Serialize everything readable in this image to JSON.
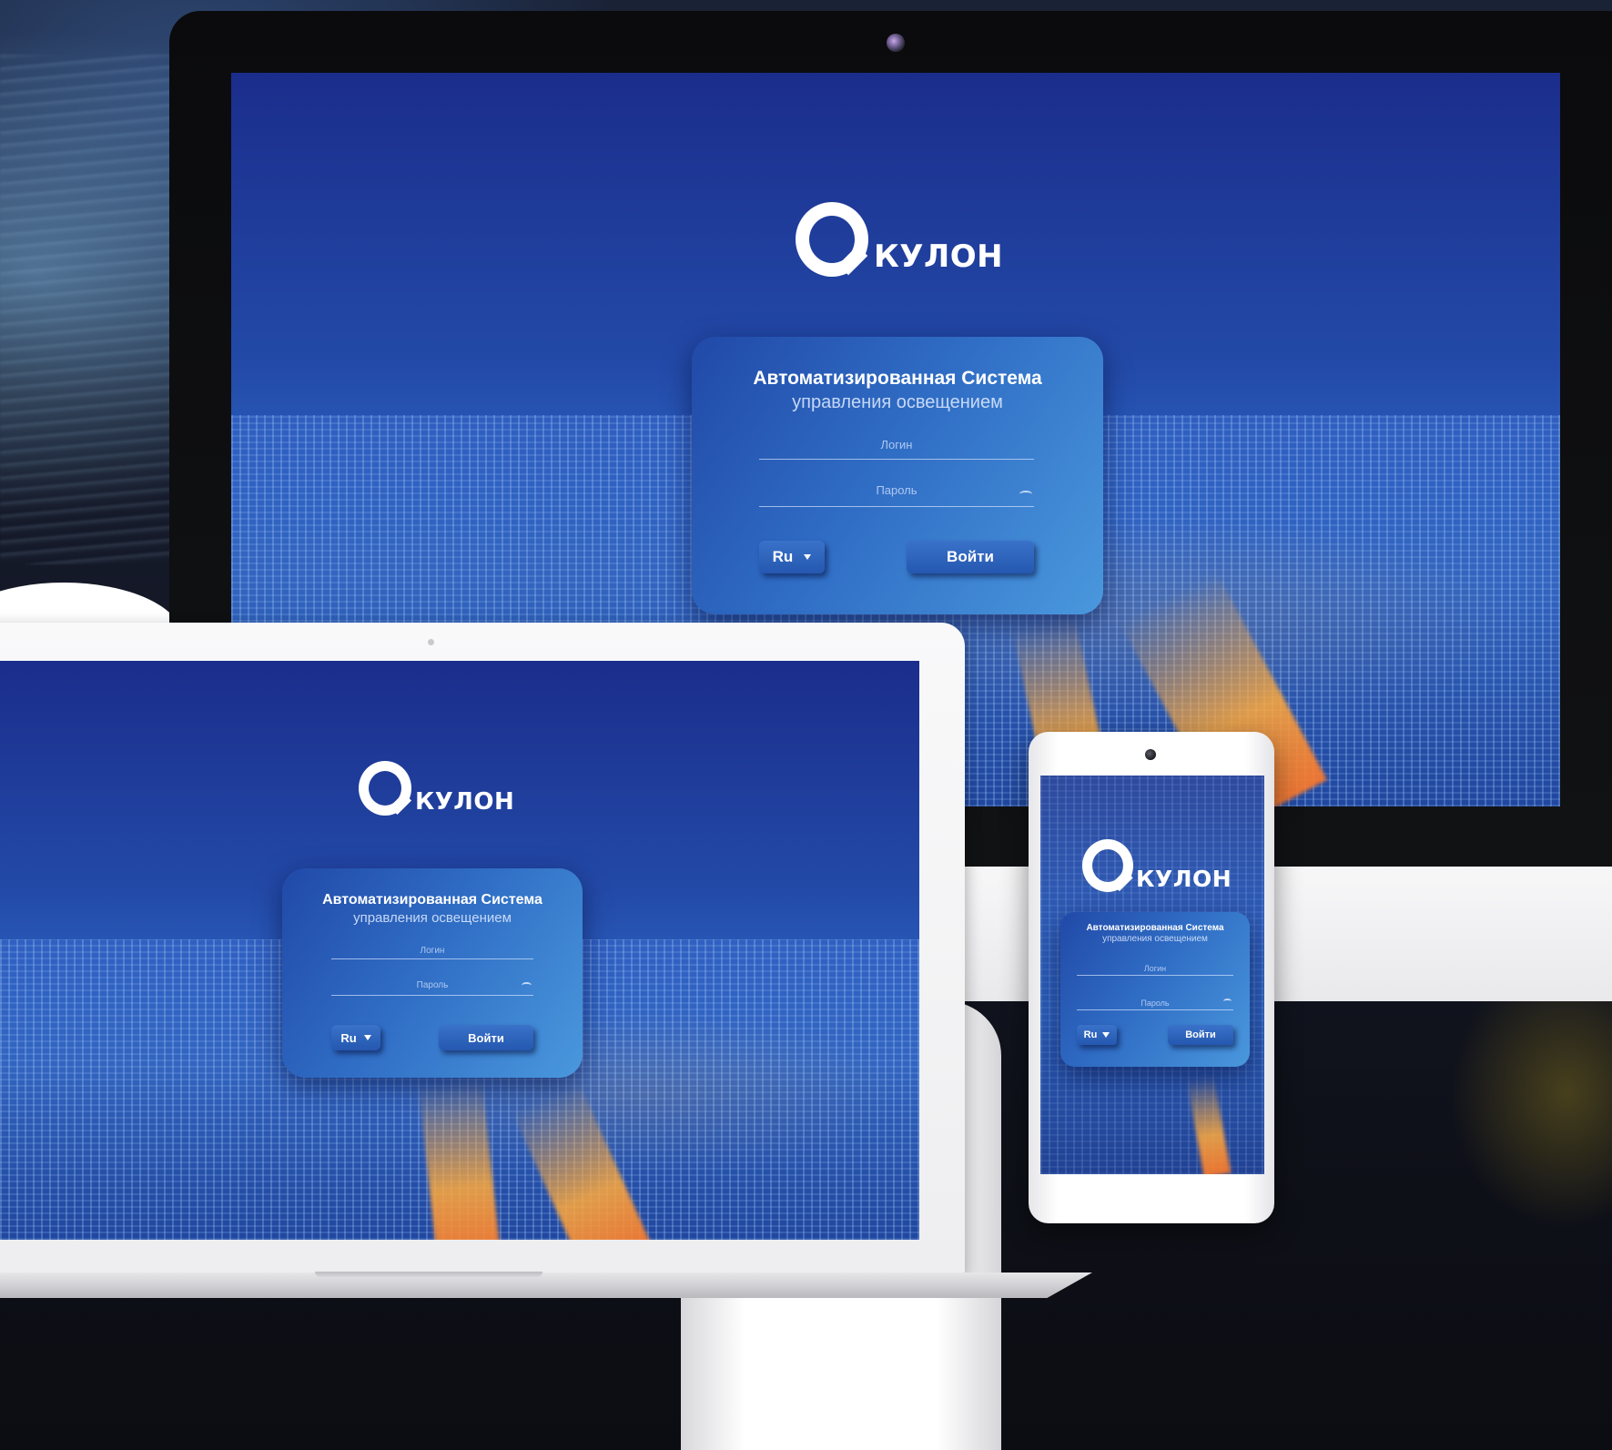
{
  "brand": {
    "name": "КУЛОН",
    "accent_color": "#2f6cc4",
    "card_gradient": [
      "#2149a8",
      "#4a98dd"
    ]
  },
  "login": {
    "title": "Автоматизированная Система",
    "subtitle": "управления освещением",
    "login_placeholder": "Логин",
    "password_placeholder": "Пароль",
    "language_value": "Ru",
    "submit_label": "Войти"
  },
  "icons": {
    "logo": "q-logo-icon",
    "password_toggle": "eye-icon",
    "dropdown": "caret-down-icon",
    "camera": "camera-icon"
  }
}
